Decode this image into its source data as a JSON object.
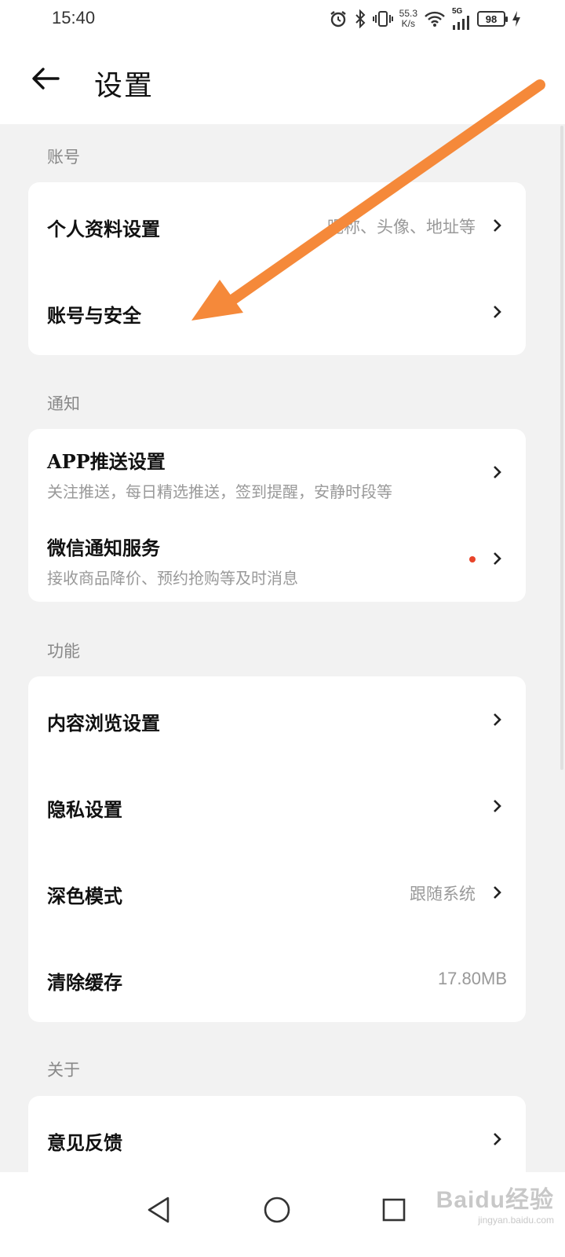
{
  "status_bar": {
    "time": "15:40",
    "net_speed_value": "55.3",
    "net_speed_unit": "K/s",
    "signal_label": "5G",
    "battery": "98",
    "icons": [
      "alarm-icon",
      "bluetooth-icon",
      "vibrate-icon",
      "wifi-icon",
      "cellular-signal-icon",
      "charging-icon"
    ]
  },
  "header": {
    "title": "设置"
  },
  "sections": {
    "account": {
      "label": "账号",
      "items": [
        {
          "title": "个人资料设置",
          "value": "昵称、头像、地址等"
        },
        {
          "title": "账号与安全"
        }
      ]
    },
    "notify": {
      "label": "通知",
      "items": [
        {
          "title": "APP推送设置",
          "subtitle": "关注推送，每日精选推送，签到提醒，安静时段等"
        },
        {
          "title": "微信通知服务",
          "subtitle": "接收商品降价、预约抢购等及时消息"
        }
      ]
    },
    "function": {
      "label": "功能",
      "items": [
        {
          "title": "内容浏览设置"
        },
        {
          "title": "隐私设置"
        },
        {
          "title": "深色模式",
          "value": "跟随系统"
        },
        {
          "title": "清除缓存",
          "value": "17.80MB"
        }
      ]
    },
    "about": {
      "label": "关于",
      "items": [
        {
          "title": "意见反馈"
        }
      ]
    }
  },
  "annotation": {
    "arrow_color": "#f5893a"
  },
  "watermark": {
    "logo": "Baidu经验",
    "url": "jingyan.baidu.com"
  },
  "nav": {
    "icons": [
      "back-triangle-icon",
      "home-circle-icon",
      "recents-square-icon"
    ]
  }
}
